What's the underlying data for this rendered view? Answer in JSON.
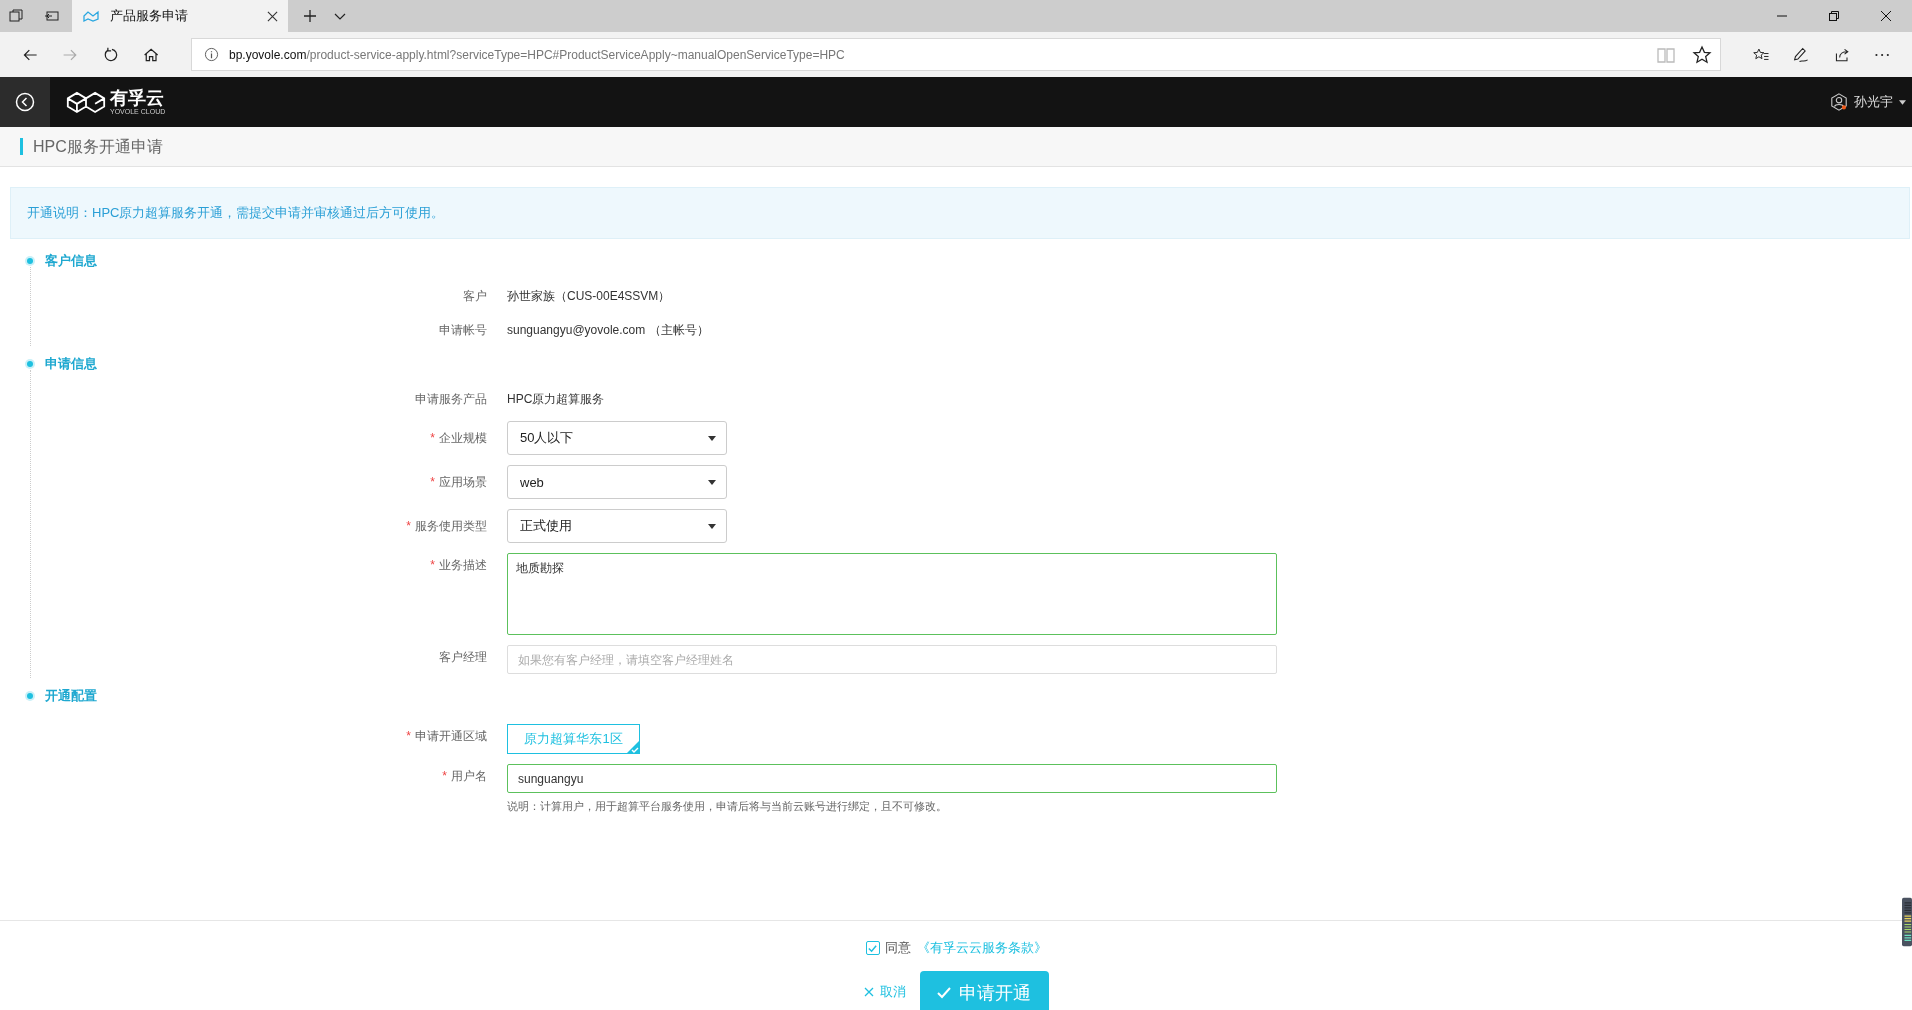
{
  "browser": {
    "tab_title": "产品服务申请",
    "url_host": "bp.yovole.com",
    "url_path": "/product-service-apply.html?serviceType=HPC#ProductServiceApply~manualOpenServiceType=HPC"
  },
  "header": {
    "logo_text": "有孚云",
    "logo_subtext": "YOVOLE CLOUD",
    "user": "孙光宇"
  },
  "page_title": "HPC服务开通申请",
  "notice": "开通说明：HPC原力超算服务开通，需提交申请并审核通过后方可使用。",
  "sections": [
    {
      "title": "客户信息",
      "rows": [
        {
          "kind": "text",
          "label": "客户",
          "value": "孙世家族（CUS-00E4SSVM）"
        },
        {
          "kind": "text",
          "label": "申请帐号",
          "value": "sunguangyu@yovole.com （主帐号）"
        }
      ]
    },
    {
      "title": "申请信息",
      "rows": [
        {
          "kind": "text",
          "label": "申请服务产品",
          "value": "HPC原力超算服务"
        },
        {
          "kind": "select",
          "label": "企业规模",
          "required_mark": "*",
          "value": "50人以下"
        },
        {
          "kind": "select",
          "label": "应用场景",
          "required_mark": "*",
          "value": "web"
        },
        {
          "kind": "select",
          "label": "服务使用类型",
          "required_mark": "*",
          "value": "正式使用"
        },
        {
          "kind": "textarea",
          "label": "业务描述",
          "required_mark": "*",
          "value": "地质勘探",
          "valid": true
        },
        {
          "kind": "input",
          "label": "客户经理",
          "placeholder": "如果您有客户经理，请填空客户经理姓名",
          "valid": false
        }
      ]
    },
    {
      "title": "开通配置",
      "rows": [
        {
          "kind": "region",
          "label": "申请开通区域",
          "required_mark": "*",
          "options": [
            {
              "label": "原力超算华东1区",
              "selected": true
            }
          ]
        },
        {
          "kind": "input",
          "label": "用户名",
          "required_mark": "*",
          "value": "sunguangyu",
          "valid": true,
          "help": "说明：计算用户，用于超算平台服务使用，申请后将与当前云账号进行绑定，且不可修改。"
        }
      ]
    }
  ],
  "agreement": {
    "checked": true,
    "label": "同意",
    "link": "《有孚云云服务条款》"
  },
  "buttons": {
    "cancel": "取消",
    "submit": "申请开通"
  }
}
